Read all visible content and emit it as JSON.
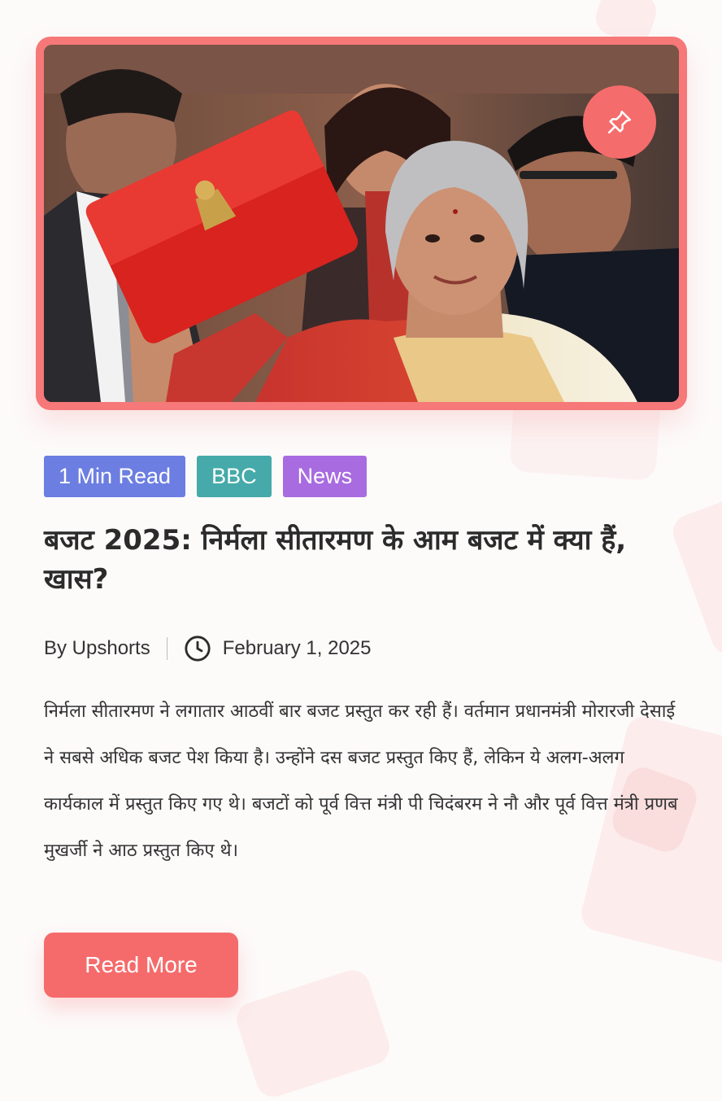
{
  "colors": {
    "accent": "#f56b6b",
    "card_border": "#f67878",
    "tag_read_time": "#6c7ee1",
    "tag_source": "#45aaa9",
    "tag_category": "#a86be0",
    "title": "#2b2b2b",
    "body_text": "#333333"
  },
  "hero": {
    "image_icon": "photo",
    "pin_icon": "pushpin-icon"
  },
  "tags": [
    {
      "label": "1 Min Read",
      "color": "#6c7ee1"
    },
    {
      "label": "BBC",
      "color": "#45aaa9"
    },
    {
      "label": "News",
      "color": "#a86be0"
    }
  ],
  "article": {
    "title": "बजट 2025: निर्मला सीतारमण के आम बजट में क्या हैं, खास?",
    "author": "By Upshorts",
    "date_icon": "clock-icon",
    "date": "February 1, 2025",
    "excerpt": "निर्मला सीतारमण ने लगातार आठवीं बार बजट प्रस्तुत कर रही हैं। वर्तमान प्रधानमंत्री मोरारजी देसाई ने सबसे अधिक बजट पेश किया है। उन्होंने दस बजट प्रस्तुत किए हैं, लेकिन ये अलग-अलग कार्यकाल में प्रस्तुत किए गए थे। बजटों को पूर्व वित्त मंत्री पी चिदंबरम ने नौ और पूर्व वित्त मंत्री प्रणब मुखर्जी ने आठ प्रस्तुत किए थे।"
  },
  "actions": {
    "read_more_label": "Read More"
  }
}
